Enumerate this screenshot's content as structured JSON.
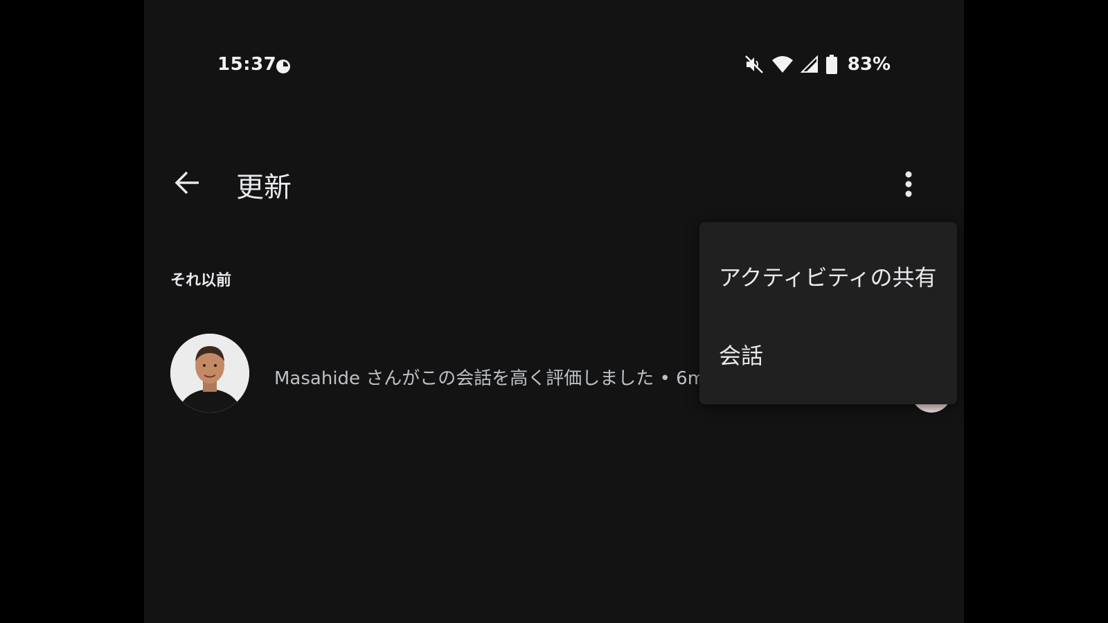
{
  "status_bar": {
    "time": "15:37",
    "battery_percent": "83%",
    "icons": [
      "circle-status-icon",
      "mute-icon",
      "wifi-icon",
      "signal-icon",
      "battery-icon"
    ]
  },
  "app_bar": {
    "title": "更新",
    "back_icon": "arrow-left-icon",
    "overflow_icon": "more-vert-icon"
  },
  "section": {
    "header": "それ以前"
  },
  "updates": [
    {
      "text": "Masahide さんがこの会話を高く評価しました • 6m",
      "reaction_icon": "heart-icon"
    }
  ],
  "menu": {
    "items": [
      {
        "label": "アクティビティの共有"
      },
      {
        "label": "会話"
      }
    ]
  },
  "colors": {
    "background": "#131313",
    "menu_background": "#202020",
    "heart": "#ea4335",
    "heart_badge_bg": "#fce8e6"
  }
}
